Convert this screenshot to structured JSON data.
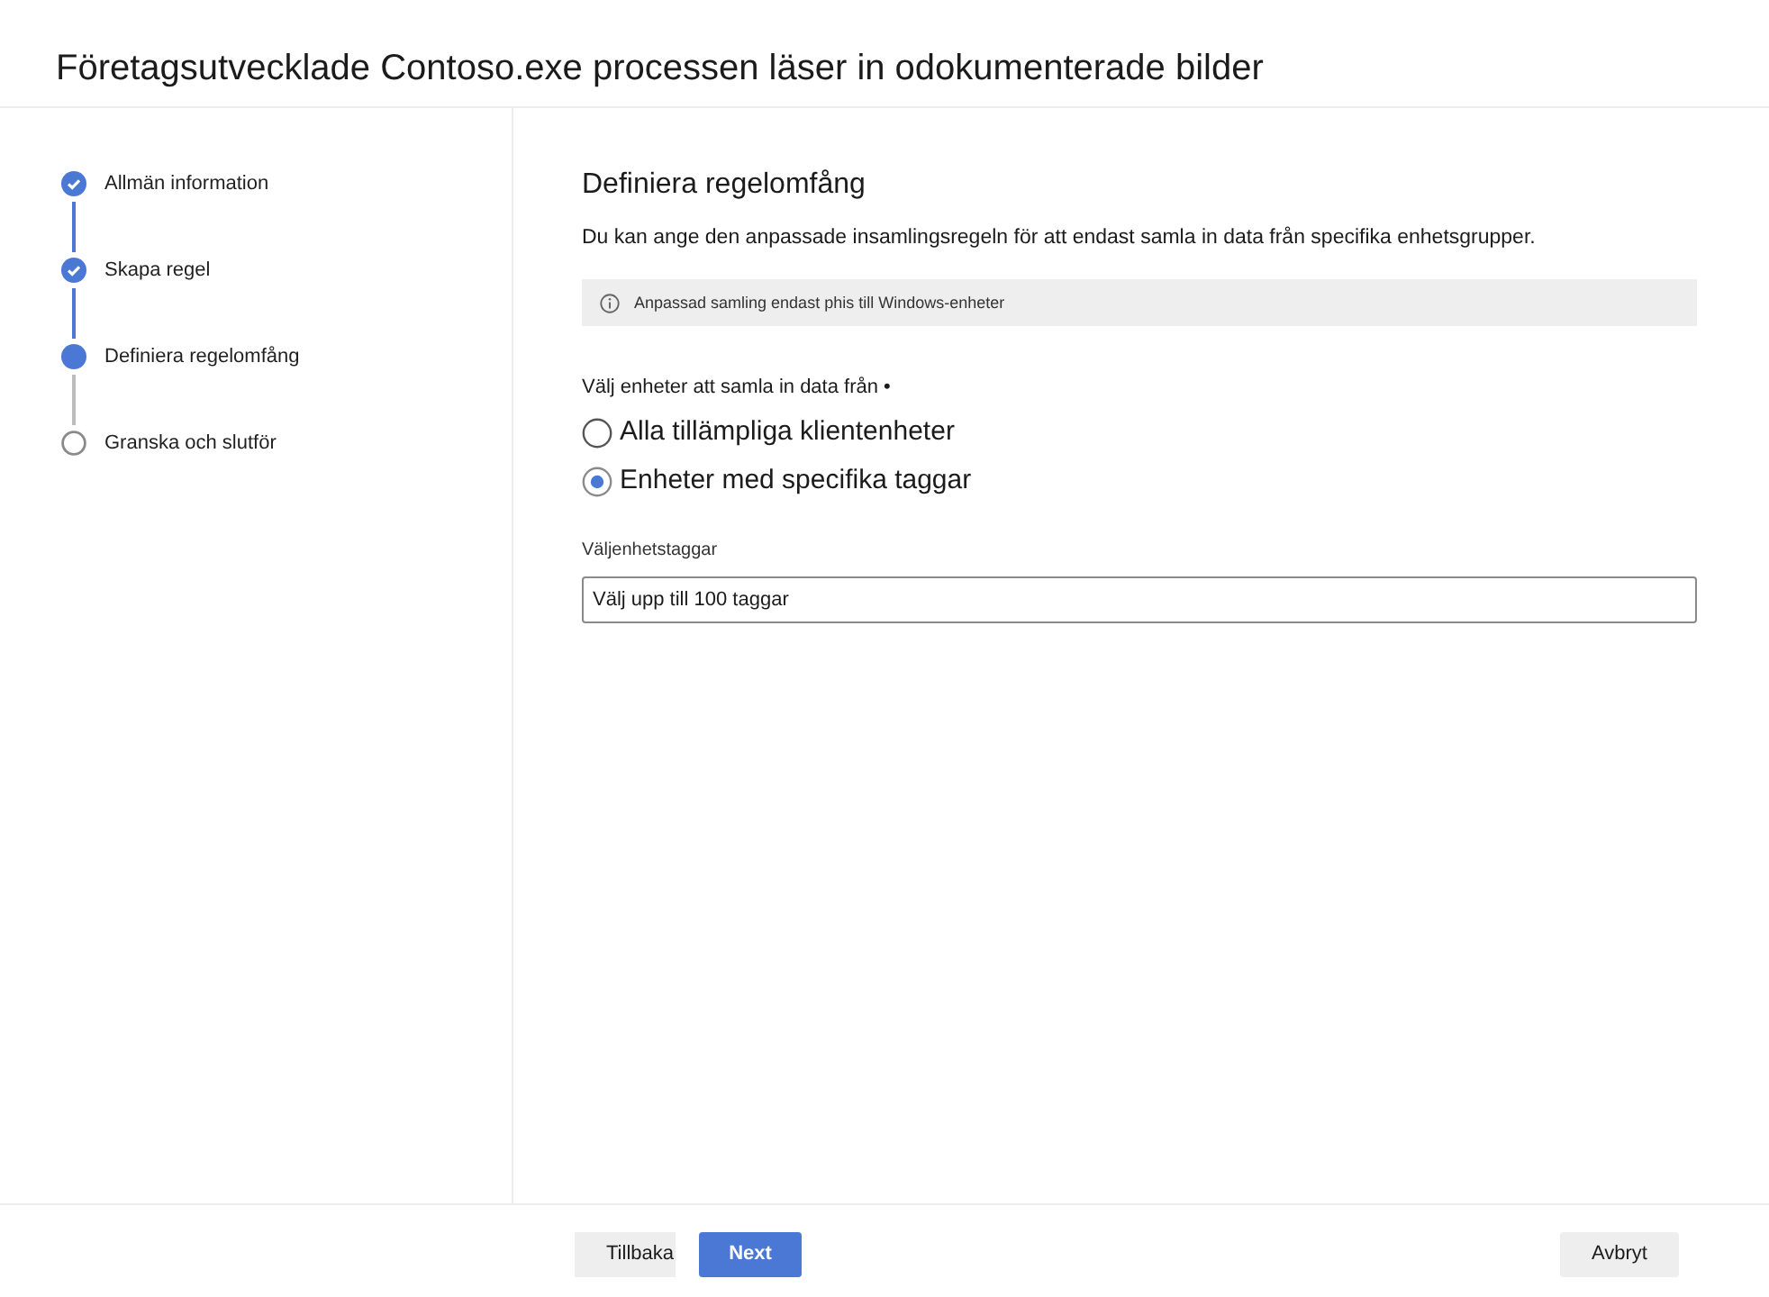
{
  "title": "Företagsutvecklade Contoso.exe processen läser in odokumenterade bilder",
  "steps": [
    {
      "label": "Allmän information",
      "kind": "completed"
    },
    {
      "label": "Skapa regel",
      "kind": "completed"
    },
    {
      "label": "Definiera regelomfång",
      "kind": "current"
    },
    {
      "label": "Granska och slutför",
      "kind": "upcoming"
    }
  ],
  "section": {
    "heading": "Definiera regelomfång",
    "description": "Du kan ange den anpassade insamlingsregeln för att endast samla in data från specifika enhetsgrupper.",
    "info": "Anpassad samling endast phis till Windows-enheter"
  },
  "device_choice": {
    "label": "Välj enheter att samla in data från •",
    "options": [
      {
        "label": "Alla tillämpliga klientenheter",
        "selected": false
      },
      {
        "label": "Enheter med specifika taggar",
        "selected": true
      }
    ]
  },
  "tags_field": {
    "label": "Väljenhetstaggar",
    "placeholder": "Välj upp till 100 taggar"
  },
  "footer": {
    "back": "Tillbaka",
    "next": "Next",
    "cancel": "Avbryt"
  }
}
